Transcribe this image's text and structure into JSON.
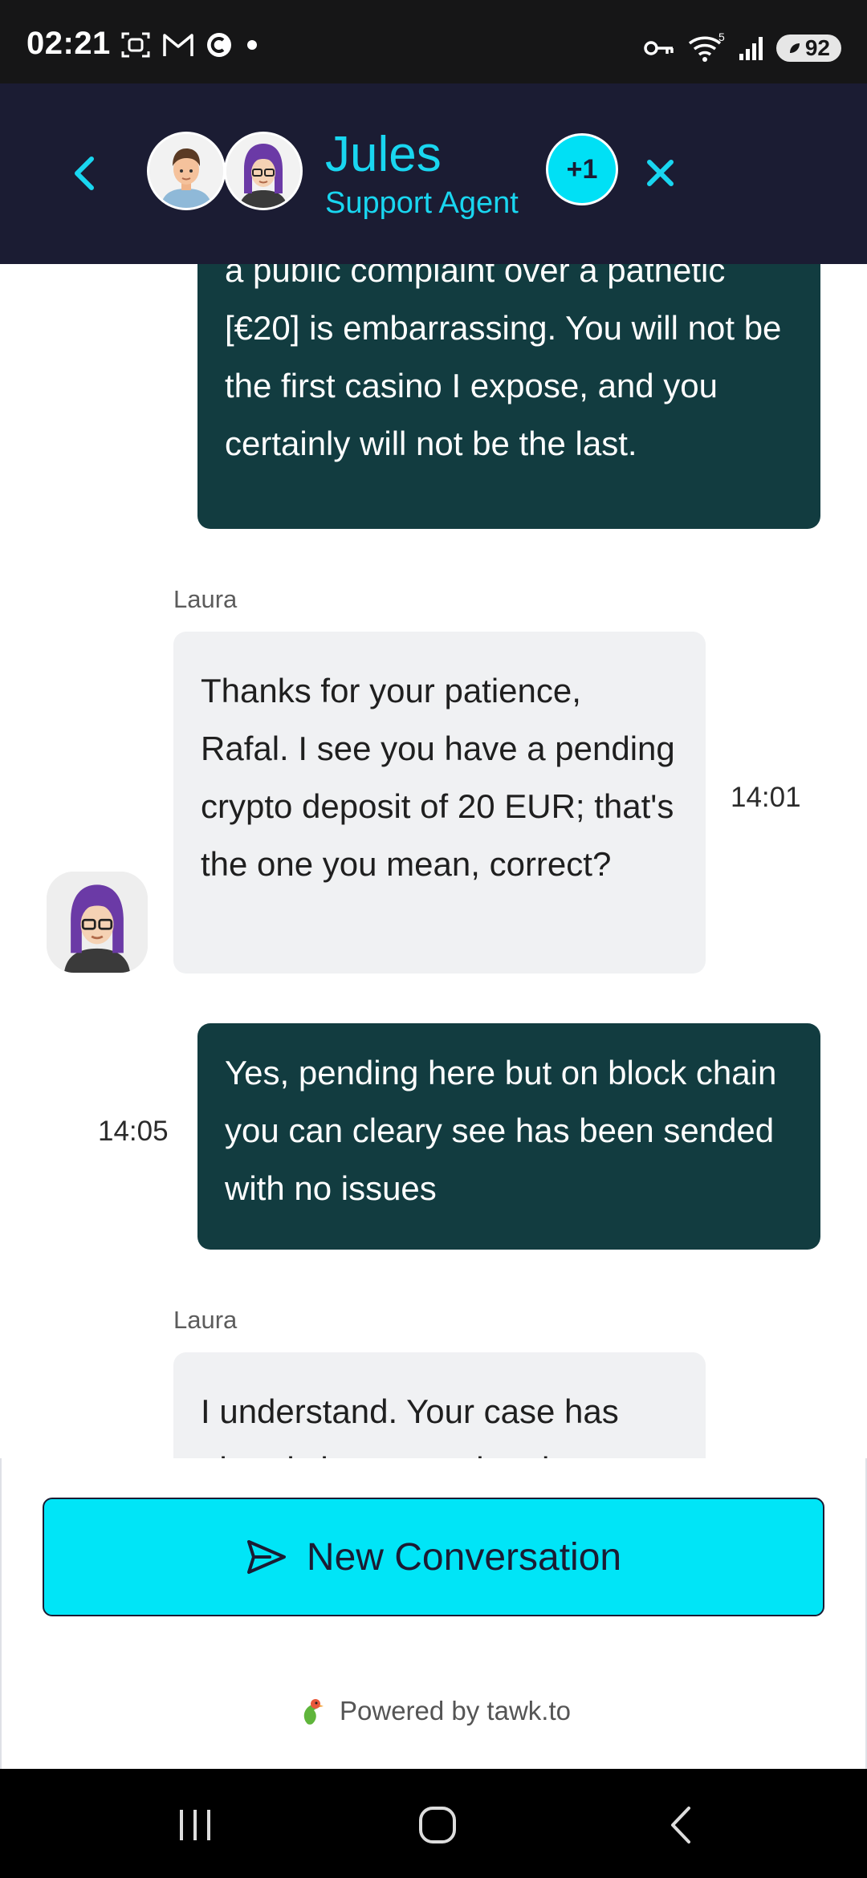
{
  "status_bar": {
    "time": "02:21",
    "network_label": "5",
    "battery": "92"
  },
  "header": {
    "agent_name": "Jules",
    "agent_role": "Support Agent",
    "more_agents": "+1"
  },
  "messages": [
    {
      "direction": "outgoing",
      "text": "a public complaint over a pathetic [€20] is embarrassing. You will not be the first casino I expose, and you certainly will not be the last."
    },
    {
      "direction": "incoming",
      "sender": "Laura",
      "text": "Thanks for your patience, Rafal. I see you have a pending crypto deposit of 20 EUR; that's the one you mean, correct?",
      "time": "14:01"
    },
    {
      "direction": "outgoing",
      "text": "Yes, pending here but on block chain you can cleary see has been sended with no issues",
      "time": "14:05"
    },
    {
      "direction": "incoming",
      "sender": "Laura",
      "text": "I understand. Your case has already been escalated to"
    }
  ],
  "actions": {
    "new_conversation": "New Conversation"
  },
  "footer": {
    "powered_by": "Powered by tawk.to"
  },
  "colors": {
    "header_bg": "#1b1c33",
    "accent": "#00e5f7",
    "outgoing_bubble": "#123c40",
    "incoming_bubble": "#f0f1f3"
  }
}
